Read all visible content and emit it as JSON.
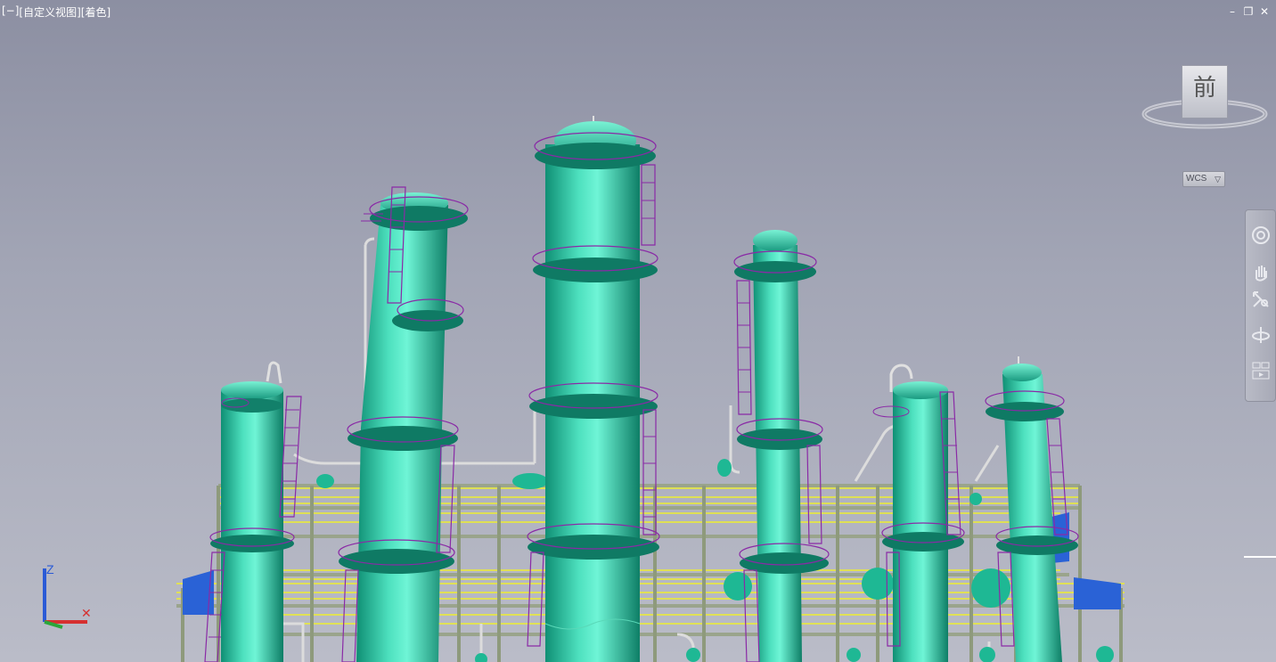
{
  "viewport": {
    "controls_bracket": "[−]",
    "view_name": "[自定义视图]",
    "visual_style": "[着色]"
  },
  "window_controls": {
    "minimize": "–",
    "restore": "❐",
    "close": "✕"
  },
  "viewcube": {
    "face_label": "前"
  },
  "wcs_menu": {
    "label": "WCS"
  },
  "navbar": {
    "icons": [
      "steering-wheel-icon",
      "pan-icon",
      "zoom-extents-icon",
      "orbit-icon",
      "showmotion-icon"
    ]
  },
  "ucs_icon": {
    "axis_z": "Z",
    "axis_x_symbol": "✕"
  },
  "colors": {
    "tower": "#1fa58c",
    "tower_highlight": "#62f0d2",
    "ladder": "#8a2aa6",
    "walkway": "#f0f02a",
    "structure": "#9aa88a",
    "pipe": "#d8d8d8",
    "grating": "#2a6ad8"
  }
}
